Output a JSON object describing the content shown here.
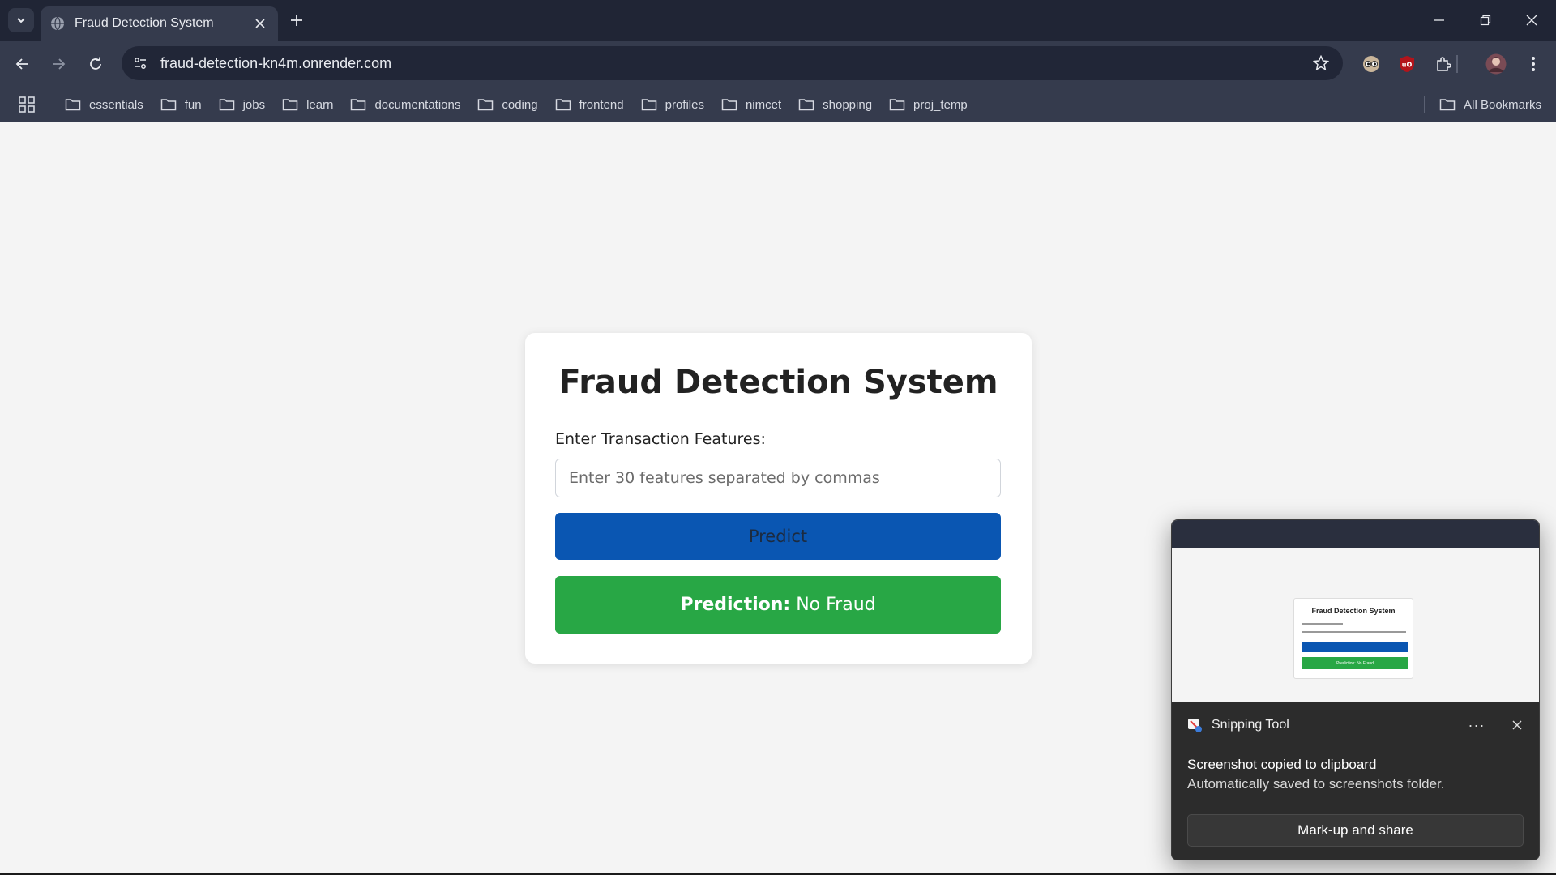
{
  "browser": {
    "tab": {
      "title": "Fraud Detection System"
    },
    "address_bar": {
      "url": "fraud-detection-kn4m.onrender.com"
    },
    "bookmarks": [
      "essentials",
      "fun",
      "jobs",
      "learn",
      "documentations",
      "coding",
      "frontend",
      "profiles",
      "nimcet",
      "shopping",
      "proj_temp"
    ],
    "all_bookmarks_label": "All Bookmarks",
    "colors": {
      "frame": "#202535",
      "toolbar": "#353b4d",
      "omnibox": "#212637"
    }
  },
  "page": {
    "title": "Fraud Detection System",
    "input_label": "Enter Transaction Features:",
    "input": {
      "value": "",
      "placeholder": "Enter 30 features separated by commas"
    },
    "predict_button": "Predict",
    "result": {
      "label": "Prediction:",
      "value": "No Fraud"
    },
    "colors": {
      "predict": "#0a56b2",
      "result": "#28a745",
      "background": "#f4f4f4"
    }
  },
  "toast": {
    "app_name": "Snipping Tool",
    "more_label": "···",
    "title": "Screenshot copied to clipboard",
    "body": "Automatically saved to screenshots folder.",
    "action_button": "Mark-up and share",
    "thumbnail": {
      "title": "Fraud Detection System",
      "result": "Prediction: No Fraud"
    }
  }
}
